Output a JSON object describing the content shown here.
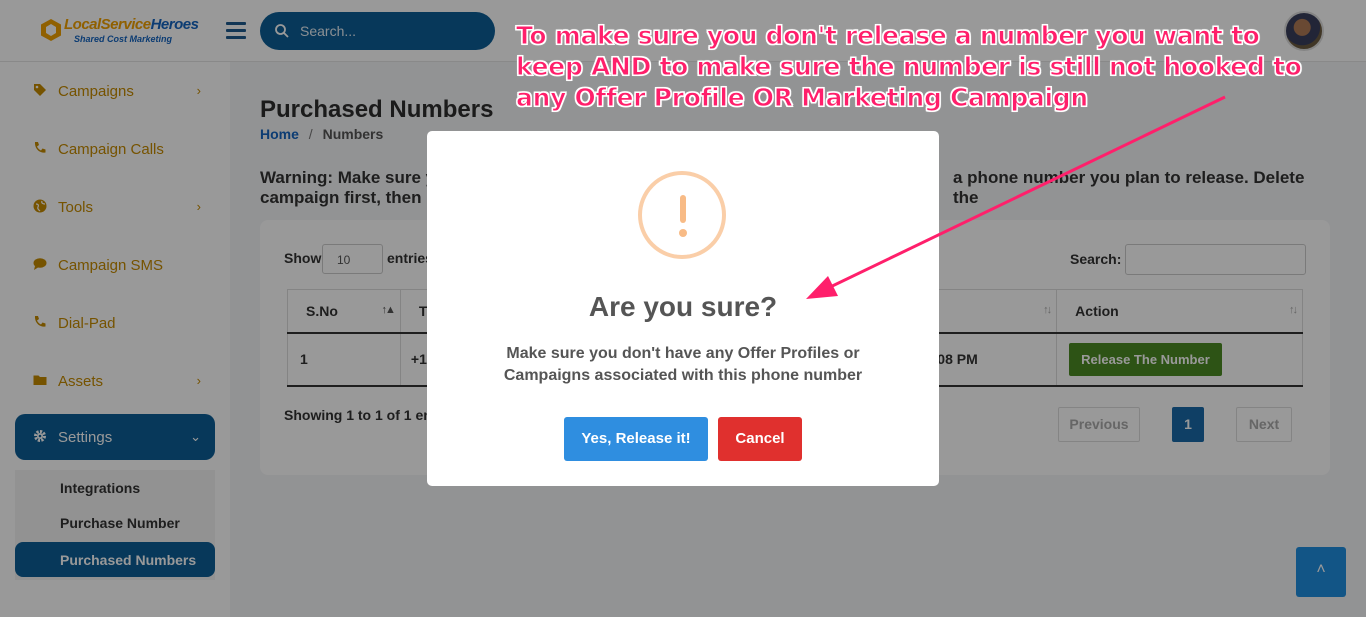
{
  "brand": {
    "name_part1": "LocalService",
    "name_part2": "Heroes",
    "tagline": "Shared Cost Marketing"
  },
  "search": {
    "placeholder": "Search..."
  },
  "sidebar": {
    "items": [
      {
        "label": "Campaigns",
        "icon": "tag-icon",
        "chevron": "›"
      },
      {
        "label": "Campaign Calls",
        "icon": "phone-icon"
      },
      {
        "label": "Tools",
        "icon": "globe-icon",
        "chevron": "›"
      },
      {
        "label": "Campaign SMS",
        "icon": "chat-icon"
      },
      {
        "label": "Dial-Pad",
        "icon": "phone-icon"
      },
      {
        "label": "Assets",
        "icon": "folder-icon",
        "chevron": "›"
      },
      {
        "label": "Settings",
        "icon": "gear-icon",
        "chevron": "⌄"
      }
    ],
    "submenu": [
      "Integrations",
      "Purchase Number",
      "Purchased Numbers"
    ]
  },
  "page": {
    "title": "Purchased Numbers",
    "breadcrumb": {
      "home": "Home",
      "sep": "/",
      "current": "Numbers"
    },
    "warning_line1": "Warning: Make sure y",
    "warning_line1_end": "a phone number you plan to release. Delete the",
    "warning_line2": "campaign first, then"
  },
  "table_controls": {
    "show": "Show",
    "page_size": "10",
    "entries": "entries",
    "search_label": "Search:"
  },
  "table": {
    "headers": [
      "S.No",
      "T",
      "Action"
    ],
    "row": {
      "sno": "1",
      "number_prefix": "+1",
      "time_suffix": "08 PM",
      "action": "Release The Number"
    }
  },
  "footer": {
    "showing": "Showing 1 to 1 of 1 ent",
    "prev": "Previous",
    "page": "1",
    "next": "Next"
  },
  "scroll_top": "˄",
  "modal": {
    "title": "Are you sure?",
    "text": "Make sure you don't have any Offer Profiles or Campaigns associated with this phone number",
    "confirm": "Yes, Release it!",
    "cancel": "Cancel"
  },
  "annotation": {
    "text": "To make sure you don't release a number you want to keep AND to make sure the number is still not hooked to any Offer Profile OR Marketing Campaign",
    "color": "#ff1f6b"
  }
}
